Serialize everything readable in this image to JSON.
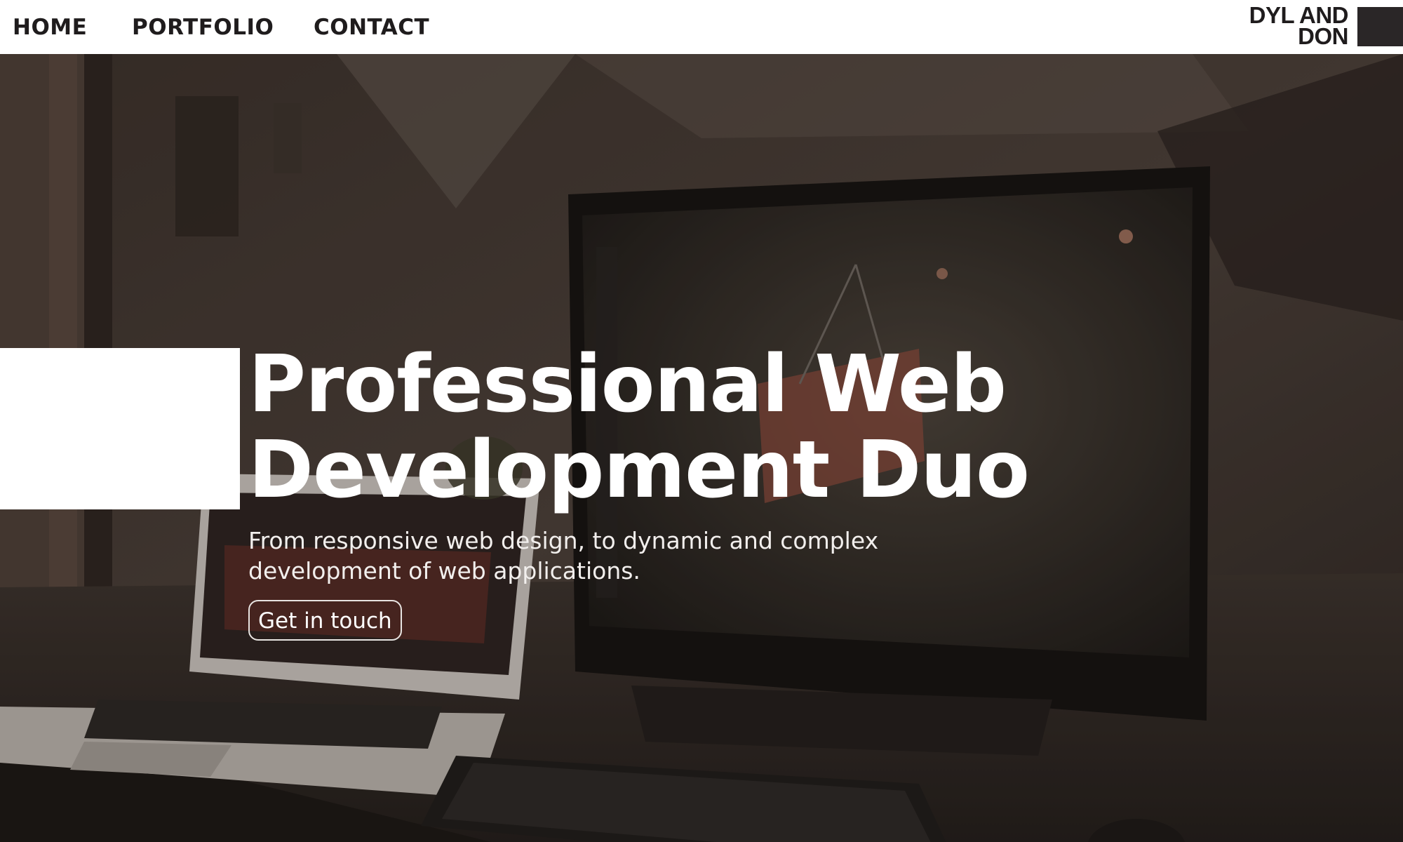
{
  "nav": {
    "items": [
      {
        "label": "HOME"
      },
      {
        "label": "PORTFOLIO"
      },
      {
        "label": "CONTACT"
      }
    ],
    "logo_line1": "DYL AND",
    "logo_line2": "DON"
  },
  "hero": {
    "title_line1": "Professional Web",
    "title_line2": "Development Duo",
    "subtitle_line1": "From responsive web design, to dynamic and complex",
    "subtitle_line2": "development of web applications.",
    "cta_label": "Get in touch",
    "background_description_icon": "desk-workspace-photo"
  },
  "colors": {
    "nav_bg": "#ffffff",
    "nav_text": "#1f1c1d",
    "logo_block": "#2a2627",
    "hero_text": "#ffffff",
    "hero_tint": "#2e2622"
  }
}
